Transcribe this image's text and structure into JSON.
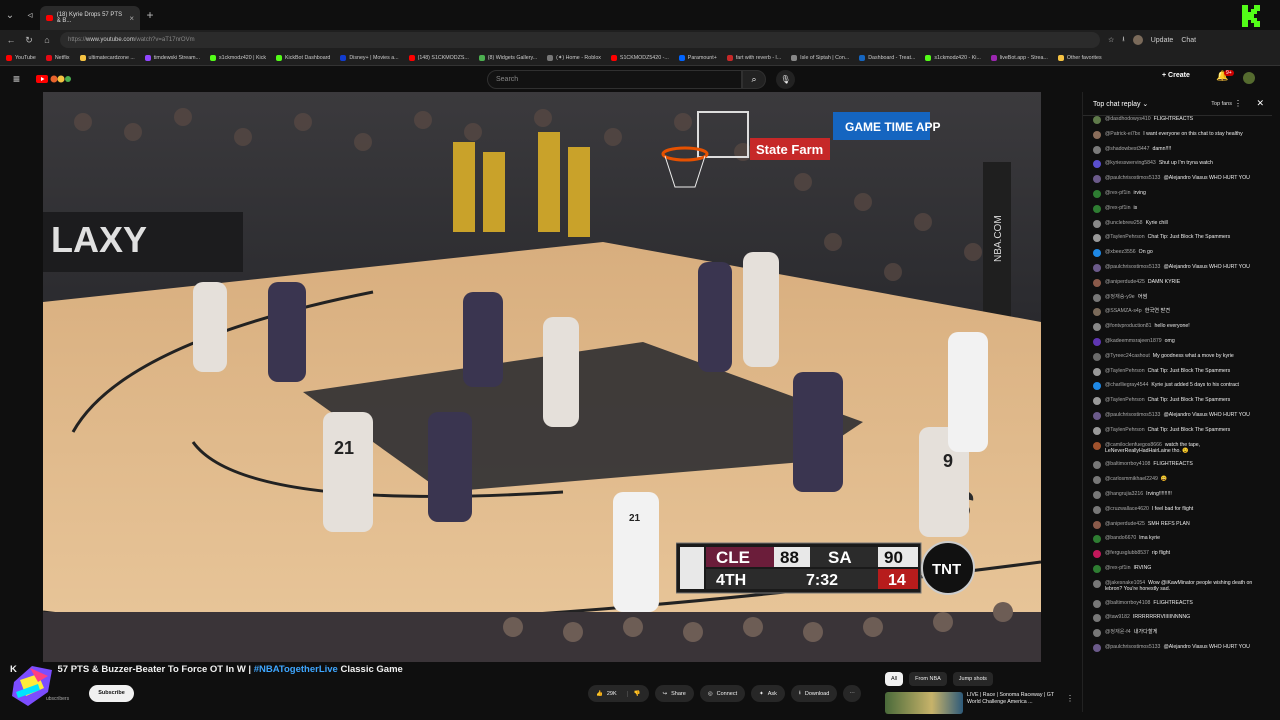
{
  "browser": {
    "tab_title": "(18) Kyrie Drops 57 PTS & B...",
    "url_prefix": "https://",
    "url_host": "www.youtube.com",
    "url_path": "/watch?v=aT17nrOVm",
    "update_label": "Update",
    "chat_label": "Chat",
    "bookmarks": [
      "YouTube",
      "Netflix",
      "ultimatecardzone ...",
      "timdewski Stream...",
      "s1ckmodz420 | Kick",
      "KickBot Dashboard",
      "Disney+ | Movies a...",
      "(148) S1CKMODZS...",
      "(8) Widgets Gallery...",
      "(✦) Home - Roblox",
      "S1CKMODZ5420 -...",
      "Paramount+",
      "fart with reverb - l...",
      "Isle of Siptah | Con...",
      "Dashboard - Treat...",
      "s1ckmodz420 - Ki...",
      "liveBot.app - Strea...",
      "Other favorites"
    ]
  },
  "yt": {
    "search_placeholder": "Search",
    "create_label": "Create",
    "notif_count": "9+"
  },
  "video": {
    "scoreboard": {
      "home_team": "CLE",
      "home_score": "88",
      "away_team": "SA",
      "away_score": "90",
      "quarter": "4TH",
      "clock": "7:32",
      "shot_clock": "14",
      "network": "TNT"
    },
    "jersey_21": "21",
    "jersey_9": "9",
    "ref_number": "21",
    "banner_game_time": "GAME TIME APP",
    "banner_state_farm": "State Farm",
    "banner_galaxy": "LAXY",
    "banner_nba": "NBA.COM"
  },
  "below_video": {
    "title_prefix": "57 PTS & Buzzer-Beater To Force OT In W | ",
    "title_hashtag": "#NBATogetherLive",
    "title_suffix": " Classic Game",
    "title_lead": "K",
    "subscribe_label": "Subscribe",
    "subscribers_text": "ubscribers",
    "likes": "29K",
    "share_label": "Share",
    "connect_label": "Connect",
    "ask_label": "Ask",
    "download_label": "Download",
    "chips": [
      "All",
      "From NBA",
      "Jump shots"
    ],
    "rec_title": "LIVE | Race | Sonoma Raceway | GT World Challenge America ..."
  },
  "chat": {
    "header": "Top chat replay",
    "top_fans": "Top fans",
    "messages": [
      {
        "author": "@dasdhodowys410",
        "text": "FLIGHTREACTS",
        "color": "#5f7a4a"
      },
      {
        "author": "@Patrick-ei7bx",
        "text": "I want everyone on this chat to stay healthy",
        "color": "#8a6d5a"
      },
      {
        "author": "@shadowbest3447",
        "text": "damn!!!!",
        "color": "#7a7a7a"
      },
      {
        "author": "@kyriesswerving5843",
        "text": "Shut up I'm tryna watch",
        "color": "#5a4fcf"
      },
      {
        "author": "@paulchrisostimos5133",
        "text": "@Alejandro Viasus WHO HURT YOU",
        "color": "#6b5a8a"
      },
      {
        "author": "@rex-pf1in",
        "text": "irving",
        "color": "#2e7d32"
      },
      {
        "author": "@rex-pf1in",
        "text": "is",
        "color": "#2e7d32"
      },
      {
        "author": "@unclebrew258",
        "text": "Kyrie chill",
        "color": "#888"
      },
      {
        "author": "@TaylenPehrson",
        "text": "Chat Tip: Just Block The Spammers",
        "color": "#999"
      },
      {
        "author": "@xbeez3556",
        "text": "On go",
        "color": "#1e88e5"
      },
      {
        "author": "@paulchrisostimos5133",
        "text": "@Alejandro Viasus WHO HURT YOU",
        "color": "#6b5a8a"
      },
      {
        "author": "@aniperdude425",
        "text": "DAMN KYRIE",
        "color": "#8a5a4a"
      },
      {
        "author": "@정재승-y9e",
        "text": "어썸",
        "color": "#777"
      },
      {
        "author": "@SSAMZA-s4p",
        "text": "한국연 받견",
        "color": "#7a6a5a"
      },
      {
        "author": "@fontvproduction81",
        "text": "hello everyone!",
        "color": "#888"
      },
      {
        "author": "@kadeemmsrajeen1879",
        "text": "omg",
        "color": "#5e35b1"
      },
      {
        "author": "@Tyreec24cashout",
        "text": "My goodness what a move by kyrie",
        "color": "#6a6a6a"
      },
      {
        "author": "@TaylenPehrson",
        "text": "Chat Tip: Just Block The Spammers",
        "color": "#999"
      },
      {
        "author": "@charlliegray4544",
        "text": "Kyrie just added 5 days to his contract",
        "color": "#1e88e5"
      },
      {
        "author": "@TaylenPehrson",
        "text": "Chat Tip: Just Block The Spammers",
        "color": "#999"
      },
      {
        "author": "@paulchrisostimos5133",
        "text": "@Alejandro Viasus WHO HURT YOU",
        "color": "#6b5a8a"
      },
      {
        "author": "@TaylenPehrson",
        "text": "Chat Tip: Just Block The Spammers",
        "color": "#999"
      },
      {
        "author": "@camiloclenfuegos8666",
        "text": "watch the tape, LeNeverReallyHadHairLaine tho. 😉",
        "color": "#a0522d"
      },
      {
        "author": "@baltimorrboy4108",
        "text": "FLIGHTREACTS",
        "color": "#777"
      },
      {
        "author": "@carlosmmikhael2249",
        "text": "😄",
        "color": "#777"
      },
      {
        "author": "@hangrujia3216",
        "text": "Irving!!!!!!!!!",
        "color": "#777"
      },
      {
        "author": "@cruzwallace4620",
        "text": "I feel bad for flight",
        "color": "#777"
      },
      {
        "author": "@aniperdude425",
        "text": "SMH REFS PLAN",
        "color": "#8a5a4a"
      },
      {
        "author": "@bando6670",
        "text": "lma kyrie",
        "color": "#2e7d32"
      },
      {
        "author": "@fergusglubb8537",
        "text": "rip flight",
        "color": "#c2185b"
      },
      {
        "author": "@rex-pf1in",
        "text": "IRVING",
        "color": "#2e7d32"
      },
      {
        "author": "@jakesnake1054",
        "text": "Wow @iKawMinator people wishing death on lebron? You're honestly sad.",
        "color": "#777"
      },
      {
        "author": "@baltimorrboy4108",
        "text": "FLIGHTREACTS",
        "color": "#777"
      },
      {
        "author": "@taw9182",
        "text": "IRRRRRRRVIIIIINNNNG",
        "color": "#777"
      },
      {
        "author": "@정재윤-f4",
        "text": "내가다할게",
        "color": "#777"
      },
      {
        "author": "@paulchrisostimos5133",
        "text": "@Alejandro Viasus WHO HURT YOU",
        "color": "#6b5a8a"
      }
    ]
  }
}
